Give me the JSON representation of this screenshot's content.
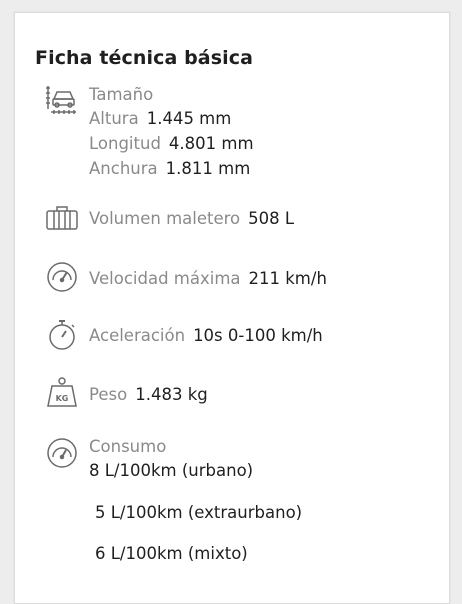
{
  "title": "Ficha técnica básica",
  "size": {
    "heading": "Tamaño",
    "items": [
      {
        "label": "Altura",
        "value": "1.445 mm"
      },
      {
        "label": "Longitud",
        "value": "4.801 mm"
      },
      {
        "label": "Anchura",
        "value": "1.811 mm"
      }
    ]
  },
  "trunk": {
    "label": "Volumen maletero",
    "value": "508 L"
  },
  "speed": {
    "label": "Velocidad máxima",
    "value": "211 km/h"
  },
  "accel": {
    "label": "Aceleración",
    "value": "10s 0-100 km/h"
  },
  "weight": {
    "label": "Peso",
    "value": "1.483 kg",
    "badge": "KG"
  },
  "consumption": {
    "heading": "Consumo",
    "values": [
      "8 L/100km (urbano)",
      "5 L/100km (extraurbano)",
      "6 L/100km (mixto)"
    ]
  },
  "icons": [
    "car-size-icon",
    "suitcase-icon",
    "speedometer-icon",
    "stopwatch-icon",
    "weight-icon",
    "fuel-gauge-icon"
  ],
  "colors": {
    "label": "#8a8a8a",
    "value": "#1f1f1f",
    "icon": "#6b6b6b",
    "background": "#ededed",
    "card": "#ffffff"
  }
}
